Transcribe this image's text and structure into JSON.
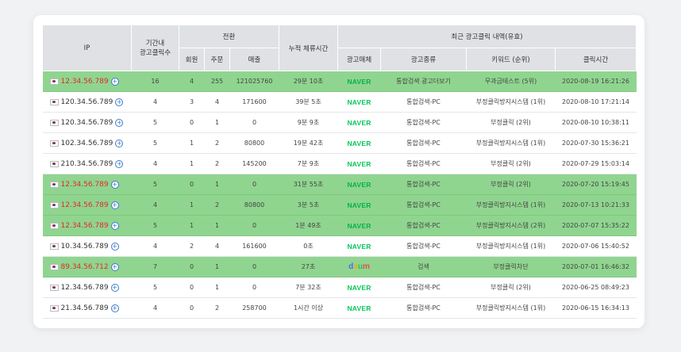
{
  "headers": {
    "ip": "IP",
    "clicks": "기간내\n광고클릭수",
    "conversion": "전환",
    "members": "회원",
    "orders": "주문",
    "sales": "매출",
    "stay": "누적 체류시간",
    "recent": "최근 광고클릭 내역(유효)",
    "media": "광고매체",
    "adtype": "광고종류",
    "keyword": "키워드 (순위)",
    "clicktime": "클릭시간"
  },
  "rows": [
    {
      "ip": "12.34.56.789",
      "highlight": true,
      "clicks": "16",
      "members": "4",
      "orders": "255",
      "sales": "121025760",
      "stay": "29분 10초",
      "media": "NAVER",
      "adtype": "통합검색 광고더보기",
      "keyword": "무과금테스트 (5위)",
      "time": "2020-08-19 16:21:26"
    },
    {
      "ip": "120.34.56.789",
      "highlight": false,
      "clicks": "4",
      "members": "3",
      "orders": "4",
      "sales": "171600",
      "stay": "39분 5초",
      "media": "NAVER",
      "adtype": "통합검색-PC",
      "keyword": "부정클릭방지시스템 (1위)",
      "time": "2020-08-10 17:21:14"
    },
    {
      "ip": "120.34.56.789",
      "highlight": false,
      "clicks": "5",
      "members": "0",
      "orders": "1",
      "sales": "0",
      "stay": "9분 9초",
      "media": "NAVER",
      "adtype": "통합검색-PC",
      "keyword": "부정클릭 (2위)",
      "time": "2020-08-10 10:38:11"
    },
    {
      "ip": "102.34.56.789",
      "highlight": false,
      "clicks": "5",
      "members": "1",
      "orders": "2",
      "sales": "80800",
      "stay": "19분 42초",
      "media": "NAVER",
      "adtype": "통합검색-PC",
      "keyword": "부정클릭방지시스템 (1위)",
      "time": "2020-07-30 15:36:21"
    },
    {
      "ip": "210.34.56.789",
      "highlight": false,
      "clicks": "4",
      "members": "1",
      "orders": "2",
      "sales": "145200",
      "stay": "7분 9초",
      "media": "NAVER",
      "adtype": "통합검색-PC",
      "keyword": "부정클릭 (2위)",
      "time": "2020-07-29 15:03:14"
    },
    {
      "ip": "12.34.56.789",
      "highlight": true,
      "clicks": "5",
      "members": "0",
      "orders": "1",
      "sales": "0",
      "stay": "31분 55초",
      "media": "NAVER",
      "adtype": "통합검색-PC",
      "keyword": "부정클릭 (2위)",
      "time": "2020-07-20 15:19:45"
    },
    {
      "ip": "12.34.56.789",
      "highlight": true,
      "clicks": "4",
      "members": "1",
      "orders": "2",
      "sales": "80800",
      "stay": "3분 5초",
      "media": "NAVER",
      "adtype": "통합검색-PC",
      "keyword": "부정클릭방지시스템 (1위)",
      "time": "2020-07-13 10:21:33"
    },
    {
      "ip": "12.34.56.789",
      "highlight": true,
      "clicks": "5",
      "members": "1",
      "orders": "1",
      "sales": "0",
      "stay": "1분 49초",
      "media": "NAVER",
      "adtype": "통합검색-PC",
      "keyword": "부정클릭방지시스템 (2위)",
      "time": "2020-07-07 15:35:22"
    },
    {
      "ip": "10.34.56.789",
      "highlight": false,
      "clicks": "4",
      "members": "2",
      "orders": "4",
      "sales": "161600",
      "stay": "0초",
      "media": "NAVER",
      "adtype": "통합검색-PC",
      "keyword": "부정클릭방지시스템 (1위)",
      "time": "2020-07-06 15:40:52"
    },
    {
      "ip": "89.34.56.712",
      "highlight": true,
      "clicks": "7",
      "members": "0",
      "orders": "1",
      "sales": "0",
      "stay": "27초",
      "media": "daum",
      "adtype": "검색",
      "keyword": "부정클릭차단",
      "time": "2020-07-01 16:46:32"
    },
    {
      "ip": "12.34.56.789",
      "highlight": false,
      "clicks": "5",
      "members": "0",
      "orders": "1",
      "sales": "0",
      "stay": "7분 32초",
      "media": "NAVER",
      "adtype": "통합검색-PC",
      "keyword": "부정클릭 (2위)",
      "time": "2020-06-25 08:49:23"
    },
    {
      "ip": "21.34.56.789",
      "highlight": false,
      "clicks": "4",
      "members": "0",
      "orders": "2",
      "sales": "258700",
      "stay": "1시간 이상",
      "media": "NAVER",
      "adtype": "통합검색-PC",
      "keyword": "부정클릭방지시스템 (1위)",
      "time": "2020-06-15 16:34:13"
    }
  ]
}
